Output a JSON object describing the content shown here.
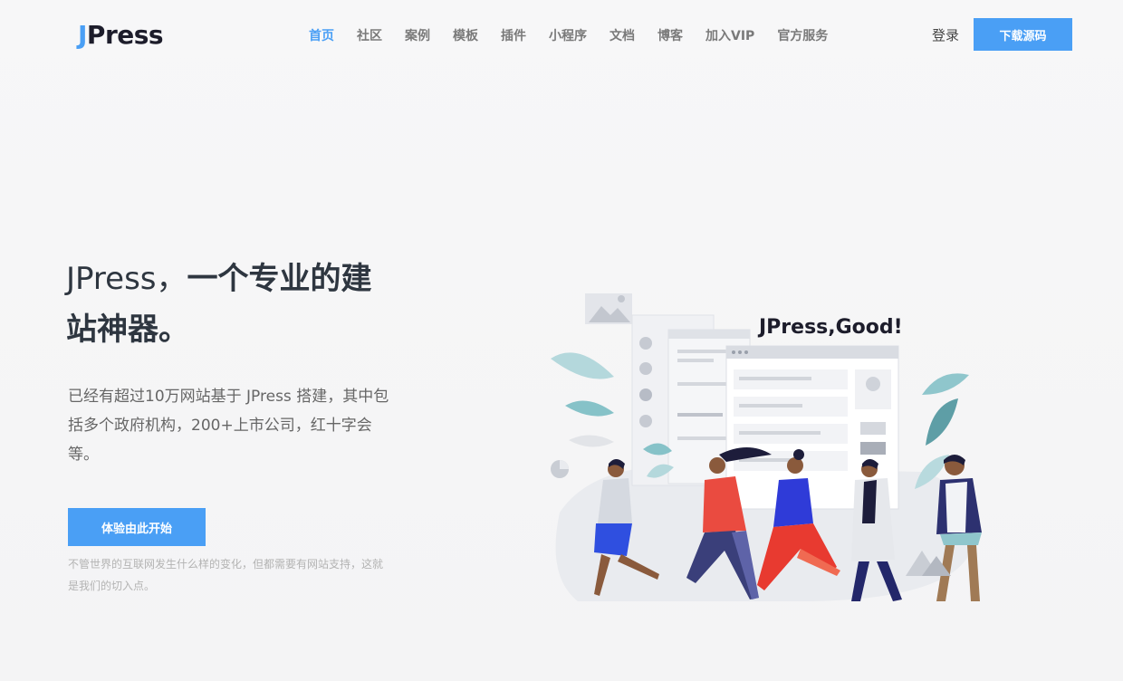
{
  "header": {
    "logo_first": "J",
    "logo_rest": "Press",
    "nav": [
      "首页",
      "社区",
      "案例",
      "模板",
      "插件",
      "小程序",
      "文档",
      "博客",
      "加入VIP",
      "官方服务"
    ],
    "login": "登录",
    "download": "下载源码"
  },
  "hero": {
    "title_brand": "JPress，",
    "title_rest": "一个专业的建站神器。",
    "description": "已经有超过10万网站基于 JPress 搭建，其中包括多个政府机构，200+上市公司，红十字会等。",
    "cta": "体验由此开始",
    "sub": "不管世界的互联网发生什么样的变化，但都需要有网站支持，这就是我们的切入点。"
  },
  "illustration": {
    "caption": "JPress,Good!"
  },
  "colors": {
    "accent": "#4a9ff5",
    "title": "#2e3640",
    "text": "#666666",
    "muted": "#b3b3b3"
  }
}
